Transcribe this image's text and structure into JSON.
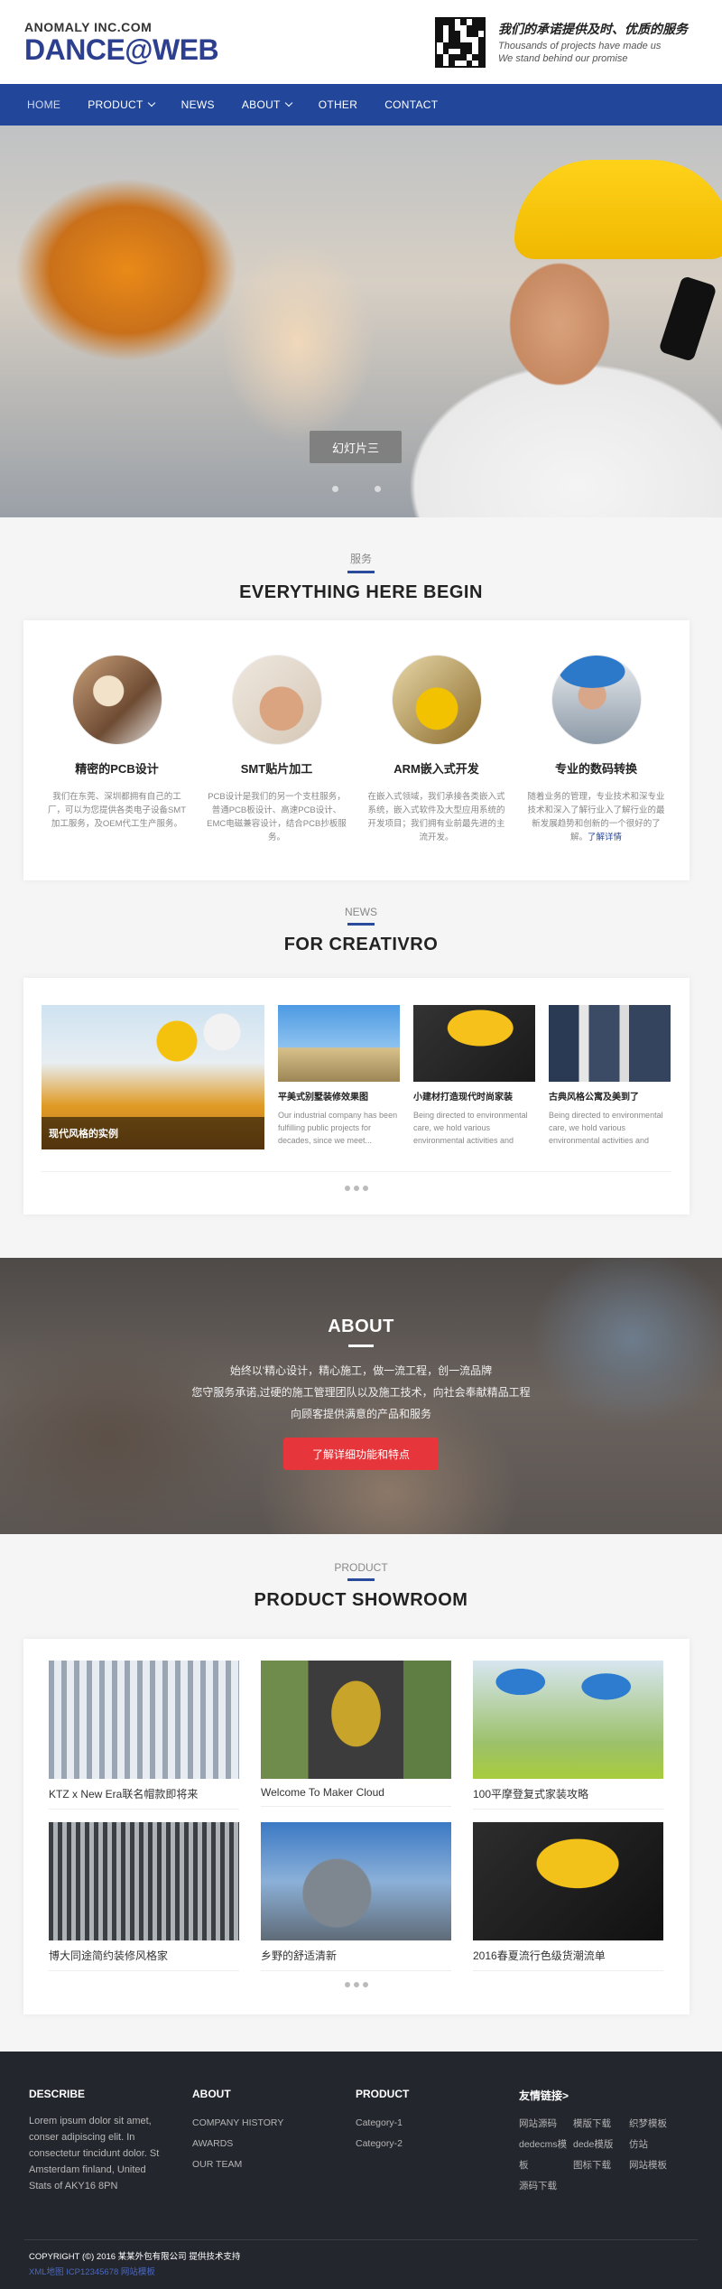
{
  "brand": {
    "company": "ANOMALY INC.COM",
    "name": "DANCE@WEB",
    "slogan_cn": "我们的承诺提供及时、优质的服务",
    "slogan_en_1": "Thousands of projects have made us",
    "slogan_en_2": "We stand behind our promise"
  },
  "nav": {
    "items": [
      {
        "label": "HOME"
      },
      {
        "label": "PRODUCT"
      },
      {
        "label": "NEWS"
      },
      {
        "label": "ABOUT"
      },
      {
        "label": "OTHER"
      },
      {
        "label": "CONTACT"
      }
    ]
  },
  "hero": {
    "caption": "幻灯片三"
  },
  "services": {
    "sub": "服务",
    "title": "EVERYTHING HERE BEGIN",
    "items": [
      {
        "title": "精密的PCB设计",
        "text": "我们在东莞、深圳都拥有自己的工厂，可以为您提供各类电子设备SMT加工服务，及OEM代工生产服务。"
      },
      {
        "title": "SMT贴片加工",
        "text": "PCB设计是我们的另一个支柱服务，普通PCB板设计、高速PCB设计、EMC电磁兼容设计，结合PCB抄板服务。"
      },
      {
        "title": "ARM嵌入式开发",
        "text": "在嵌入式领域，我们承接各类嵌入式系统，嵌入式软件及大型应用系统的开发项目；我们拥有业前最先进的主流开发。"
      },
      {
        "title": "专业的数码转换",
        "text": "随着业务的管理，专业技术和深专业技术和深入了解行业入了解行业的最新发展趋势和创新的一个很好的了解。",
        "more": "了解详情"
      }
    ]
  },
  "news": {
    "sub": "NEWS",
    "title": "FOR CREATIVRO",
    "feature_caption": "现代风格的实例",
    "items": [
      {
        "title": "平美式别墅装修效果图",
        "text": "Our industrial company has been fulfilling public projects for decades, since we meet..."
      },
      {
        "title": "小建材打造现代时尚家装",
        "text": "Being directed to environmental care, we hold various environmental activities and"
      },
      {
        "title": "古典风格公寓及美到了",
        "text": "Being directed to environmental care, we hold various environmental activities and"
      }
    ]
  },
  "about": {
    "title": "ABOUT",
    "lines": [
      "始终以'精心设计，精心施工，做一流工程，创一流品牌",
      "您守服务承诺,过硬的施工管理团队以及施工技术，向社会奉献精品工程",
      "向顾客提供满意的产品和服务"
    ],
    "button": "了解详细功能和特点"
  },
  "products": {
    "sub": "PRODUCT",
    "title": "PRODUCT SHOWROOM",
    "items": [
      {
        "title": "KTZ x New Era联名帽款即将来"
      },
      {
        "title": "Welcome To Maker Cloud"
      },
      {
        "title": "100平摩登复式家装攻略"
      },
      {
        "title": "博大同途简约装修风格家"
      },
      {
        "title": "乡野的舒适清新"
      },
      {
        "title": "2016春夏流行色级货潮流单"
      }
    ]
  },
  "footer": {
    "describe_head": "DESCRIBE",
    "describe_text": "Lorem ipsum dolor sit amet, conser adipiscing elit. In consectetur tincidunt dolor. St Amsterdam finland, United Stats of AKY16 8PN",
    "about_head": "ABOUT",
    "about_links": [
      "COMPANY HISTORY",
      "AWARDS",
      "OUR TEAM"
    ],
    "product_head": "PRODUCT",
    "product_links": [
      "Category-1",
      "Category-2"
    ],
    "friends_head": "友情链接>",
    "friends": [
      "网站源码",
      "模版下载",
      "织梦模板",
      "dedecms模",
      "dede模版",
      "仿站",
      "板",
      "图标下载",
      "网站模板",
      "源码下载"
    ],
    "copyright": "COPYRIGHT (©) 2016 某某外包有限公司 提供技术支持",
    "icp": "XML地图   ICP12345678   网站模板"
  }
}
